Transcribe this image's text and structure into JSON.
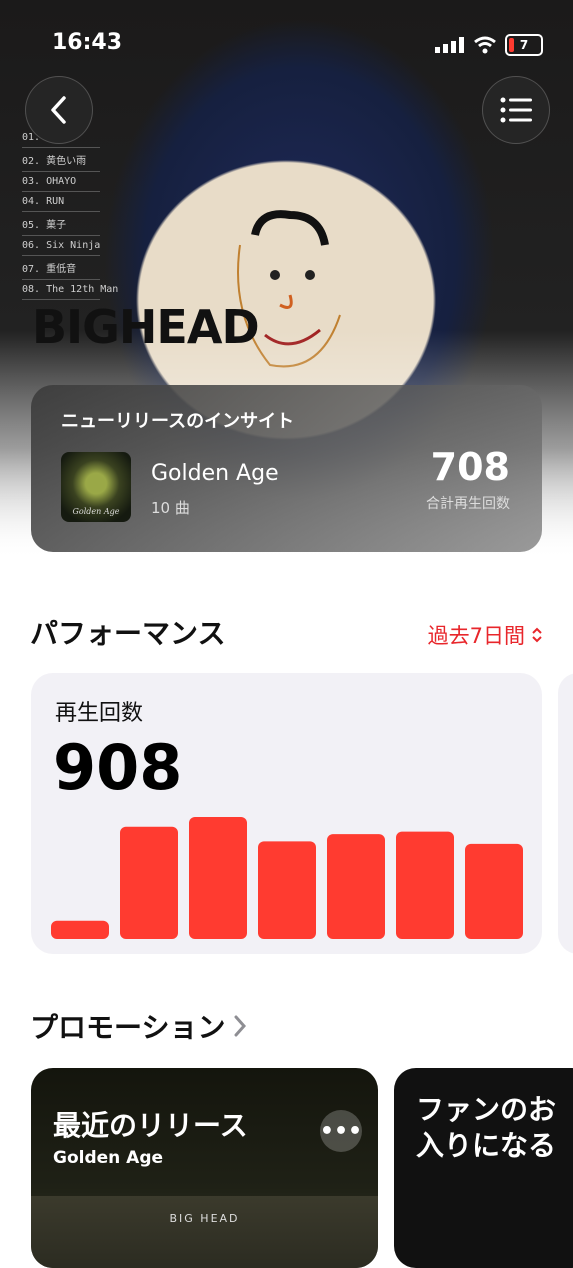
{
  "status_bar": {
    "time": "16:43",
    "battery": "7"
  },
  "hero": {
    "artist_name": "BIGHEAD",
    "tracklist": [
      "01.",
      "02. 黄色い雨",
      "03. OHAYO",
      "04. RUN",
      "05. 菓子",
      "06. Six Ninja",
      "07. 重低音",
      "08. The 12th Man"
    ]
  },
  "insight": {
    "title": "ニューリリースのインサイト",
    "album_name": "Golden Age",
    "album_art_text": "Golden Age",
    "track_count": "10 曲",
    "total_plays": "708",
    "total_plays_label": "合計再生回数"
  },
  "performance": {
    "heading": "パフォーマンス",
    "period": "過去7日間",
    "metric_label": "再生回数",
    "metric_value": "908"
  },
  "chart_data": {
    "type": "bar",
    "categories": [
      "1",
      "2",
      "3",
      "4",
      "5",
      "6",
      "7"
    ],
    "values": [
      15,
      92,
      100,
      80,
      86,
      88,
      78
    ],
    "ylim": [
      0,
      100
    ],
    "color": "#ff3b30"
  },
  "promotion": {
    "heading": "プロモーション",
    "cards": [
      {
        "title": "最近のリリース",
        "subtitle": "Golden Age",
        "art_text": "BIG HEAD"
      },
      {
        "title": "ファンのお\n入りになる"
      }
    ]
  },
  "colors": {
    "accent": "#e8262b",
    "bar": "#ff3b30"
  }
}
